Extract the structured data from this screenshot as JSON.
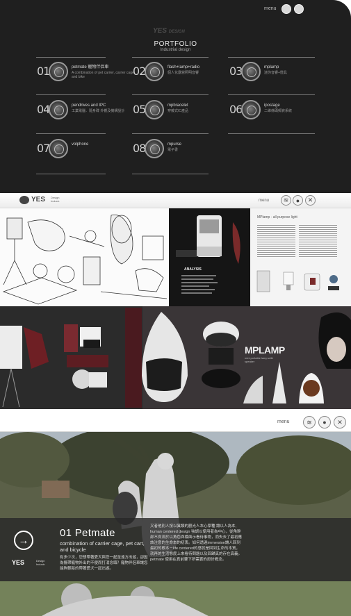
{
  "colors": {
    "dark_bg": "#1f1f1f",
    "panel_text": "#d6d6d6",
    "accent_white": "#ffffff"
  },
  "portfolio": {
    "menu_label": "menu",
    "logo_text": "YES",
    "logo_suffix": "DESIGN",
    "title": "PORTFOLIO",
    "subtitle": "Industrial design",
    "items": [
      {
        "num": "01",
        "label": "petmate 寵物伴侶車",
        "sub": "A combination of pet carrier, carrier cage and bike"
      },
      {
        "num": "02",
        "label": "flash+lamp+radio",
        "sub": "個人化露營照明音響"
      },
      {
        "num": "03",
        "label": "mplamp",
        "sub": "迷你音響+燈具"
      },
      {
        "num": "04",
        "label": "pendrives and IPC",
        "sub": "工業電腦．隨身碟 外觀及機構設計"
      },
      {
        "num": "05",
        "label": "mpbracelet",
        "sub": "穿戴式IC產品"
      },
      {
        "num": "06",
        "label": "ipostage",
        "sub": "二維條碼郵資系統"
      },
      {
        "num": "07",
        "label": "volphone",
        "sub": ""
      },
      {
        "num": "08",
        "label": "mpurse",
        "sub": "電子書"
      }
    ]
  },
  "spread": {
    "logo": "YES",
    "logo_sub": "Design\nIndustr.",
    "menu_label": "menu",
    "panel_title": "MPlamp - all purpose light",
    "analysis_label": "ANALYSIS"
  },
  "product": {
    "brand": "MPLAMP",
    "brand_sub": "mini portable lamp with speaker"
  },
  "hero": {
    "menu_label": "menu",
    "arrow": "→",
    "logo": "YES",
    "logo_sub": "Design\nIndustr.",
    "title": "01 Petmate",
    "subtitle": "combination of carrier cage, pet cart, and bicycle",
    "zh_left": "有多少次，您想帶著愛犬與您一起至遠方出遊，卻因為攜帶寵物外出的不便而打消念頭？寵物伴侶車讓您能夠輕鬆的帶著愛犬一起出遊。",
    "zh_right": "又者他別人按以異類的觀光人本心學種 讓以人為本, human centered design 強調以使用者為中心，從角幹部不良流於以角色與標面示看待事物，而失去了最初應該注意的生命本的初衷。如何透過immersion讓人回到最初的根本－life centered的感就是回到生命的本質，就再的生活態度上來看待問題以及回歸真的存在真義。petmate 使用在真前要下所需實的設計概念。"
  }
}
